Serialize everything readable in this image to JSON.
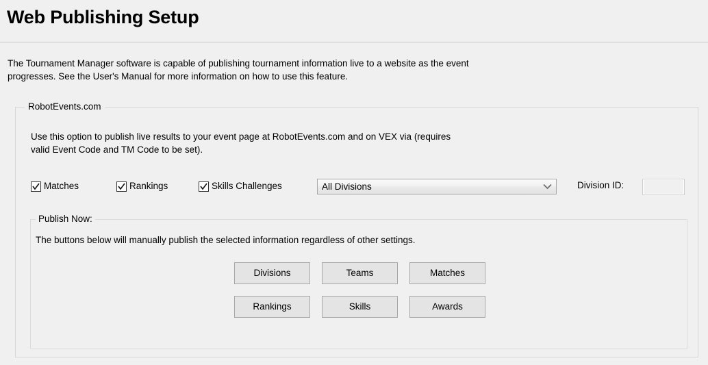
{
  "header": {
    "title": "Web Publishing Setup",
    "intro": "The Tournament Manager software is capable of publishing tournament information live to a website as the event\nprogresses.  See the User's Manual for more information on how to use this feature."
  },
  "robotevents": {
    "group_label": "RobotEvents.com",
    "description": "Use this option to publish live results to your event page at RobotEvents.com and on VEX via (requires\nvalid Event Code and TM Code to be set).",
    "checkboxes": [
      {
        "label": "Matches",
        "checked": true
      },
      {
        "label": "Rankings",
        "checked": true
      },
      {
        "label": "Skills Challenges",
        "checked": true
      }
    ],
    "division_select": {
      "selected": "All Divisions",
      "options": [
        "All Divisions"
      ],
      "icon": "chevron-down-icon"
    },
    "division_id": {
      "label": "Division ID:",
      "value": "",
      "placeholder": ""
    }
  },
  "publish_now": {
    "group_label": "Publish Now:",
    "description": "The buttons below will manually publish the selected information regardless of other settings.",
    "buttons": [
      {
        "label": "Divisions"
      },
      {
        "label": "Teams"
      },
      {
        "label": "Matches"
      },
      {
        "label": "Rankings"
      },
      {
        "label": "Skills"
      },
      {
        "label": "Awards"
      }
    ]
  },
  "colors": {
    "window_background": "#f0f0f0",
    "button_face": "#e4e4e4",
    "border": "#d6d6d6",
    "text": "#000000"
  }
}
